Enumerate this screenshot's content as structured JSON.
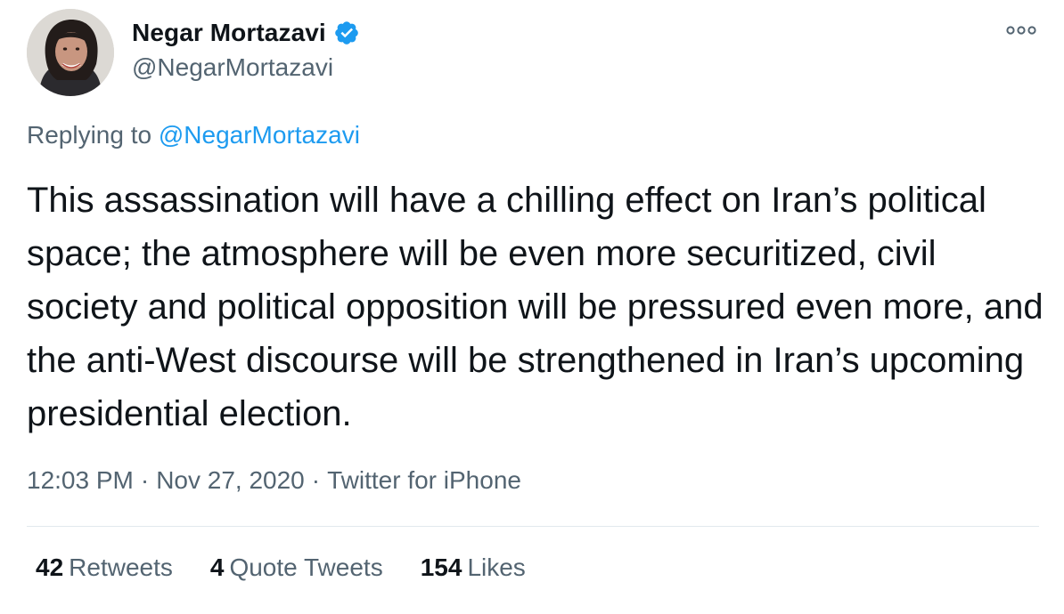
{
  "author": {
    "display_name": "Negar Mortazavi",
    "handle": "@NegarMortazavi",
    "verified": true,
    "verified_icon": "verified-badge-icon",
    "verified_color": "#1d9bf0"
  },
  "menu": {
    "icon": "more-options-icon"
  },
  "reply": {
    "prefix": "Replying to ",
    "mention": "@NegarMortazavi"
  },
  "tweet": {
    "text": "This assassination will have a chilling effect on Iran’s political space; the atmosphere will be even more securitized, civil society and political opposition will be pressured even more, and the anti-West discourse will be strengthened in Iran’s upcoming presidential election."
  },
  "meta": {
    "time": "12:03 PM",
    "separator": "·",
    "date": "Nov 27, 2020",
    "source": "Twitter for iPhone"
  },
  "stats": {
    "retweets": {
      "count": "42",
      "label": "Retweets"
    },
    "quote_tweets": {
      "count": "4",
      "label": "Quote Tweets"
    },
    "likes": {
      "count": "154",
      "label": "Likes"
    }
  },
  "colors": {
    "text_primary": "#0f1419",
    "text_secondary": "#536471",
    "link": "#1d9bf0",
    "divider": "#e1e8ed"
  }
}
